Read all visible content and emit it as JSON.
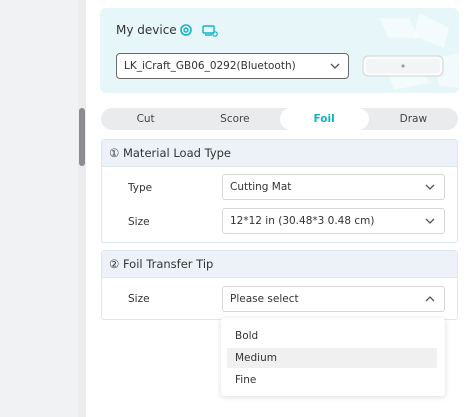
{
  "device": {
    "title": "My device",
    "selected_device": "LK_iCraft_GB06_0292(Bluetooth)"
  },
  "tabs": [
    {
      "label": "Cut",
      "active": false
    },
    {
      "label": "Score",
      "active": false
    },
    {
      "label": "Foil",
      "active": true
    },
    {
      "label": "Draw",
      "active": false
    }
  ],
  "material_section": {
    "title": "① Material Load Type",
    "type_label": "Type",
    "type_value": "Cutting Mat",
    "size_label": "Size",
    "size_value": "12*12 in (30.48*3 0.48 cm)"
  },
  "foil_section": {
    "title": "② Foil Transfer Tip",
    "size_label": "Size",
    "size_placeholder": "Please select",
    "options": [
      "Bold",
      "Medium",
      "Fine"
    ],
    "highlighted_option": "Medium"
  },
  "colors": {
    "accent": "#13b3c5",
    "device_card_bg": "#e7f6f8",
    "section_header_bg": "#edf2f8"
  }
}
